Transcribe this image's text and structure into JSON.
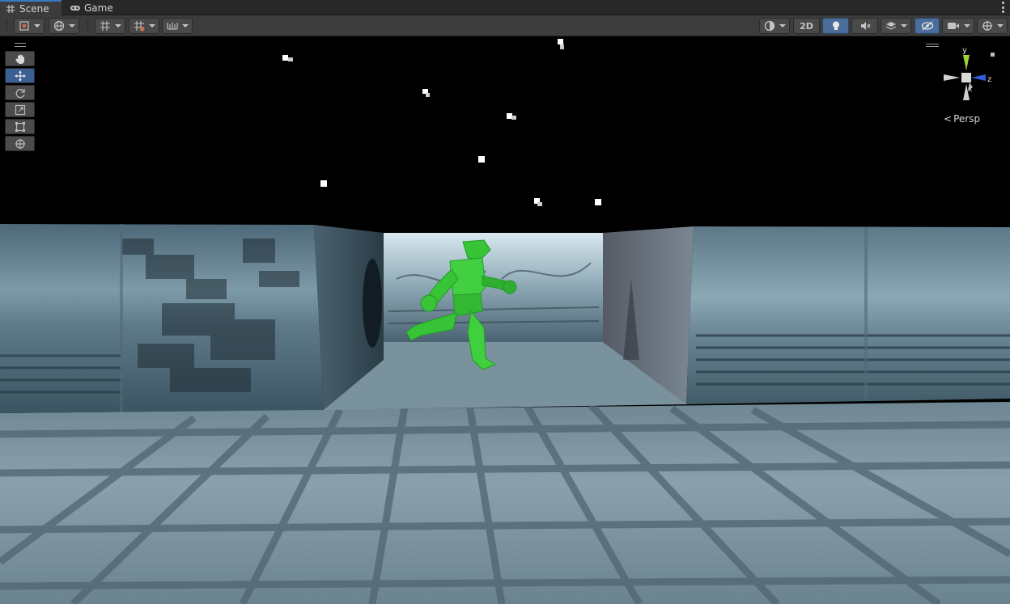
{
  "tabs": [
    {
      "label": "Scene",
      "icon": "grid-icon",
      "active": true
    },
    {
      "label": "Game",
      "icon": "gamepad-icon",
      "active": false
    }
  ],
  "toolbar": {
    "draw_mode": "shading-mode-icon",
    "view_2d_label": "2D",
    "lighting": "lightbulb-icon",
    "audio": "audio-muted-icon",
    "effects": "effects-layers-icon",
    "hidden_objects": "visibility-hidden-icon",
    "camera": "camera-icon",
    "gizmos": "gizmos-icon"
  },
  "tools": [
    "hand-tool",
    "move-tool",
    "rotate-tool",
    "scale-tool",
    "rect-tool",
    "transform-tool"
  ],
  "gizmo": {
    "y_label": "y",
    "z_label": "z",
    "x_label": "x",
    "y_color": "#9ed23a",
    "z_color": "#2f5fd6",
    "x_color": "#d8d8d8"
  },
  "projection_label": "Persp",
  "scene": {
    "character_color": "#37c437",
    "wall_color": "#5e7a88",
    "floor_color": "#8aa0aa",
    "sky_color": "#000000"
  }
}
